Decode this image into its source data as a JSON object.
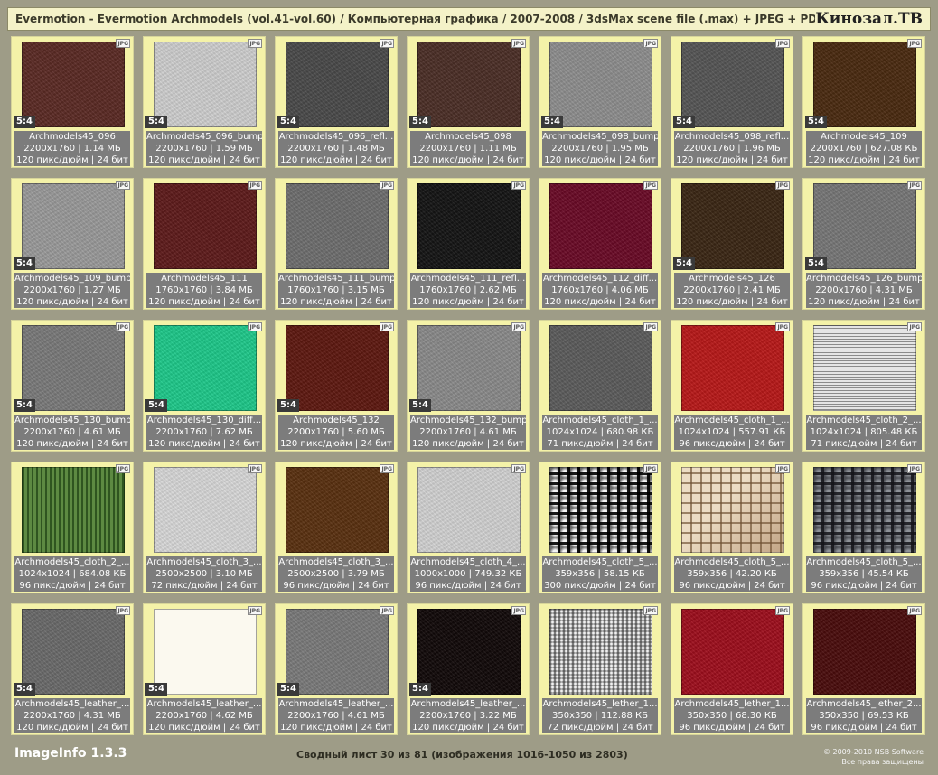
{
  "header": {
    "title": "Evermotion - Evermotion Archmodels (vol.41-vol.60) / Компьютерная графика / 2007-2008 / 3dsMax scene file (.max) + JPEG + PDF",
    "brand": "Кинозал.ТВ"
  },
  "badge_label": "JPG",
  "colors": {
    "background": "#9e9c87",
    "cell": "#f4f2a8",
    "title_bar": "#f4f2c8"
  },
  "thumbnails": [
    {
      "name": "Archmodels45_096",
      "size": "2200x1760 | 1.14 МБ",
      "meta": "120 пикс/дюйм | 24 бит",
      "ratio": "5:4",
      "color": "#5b2a24",
      "tex": "noise"
    },
    {
      "name": "Archmodels45_096_bump",
      "size": "2200x1760 | 1.59 МБ",
      "meta": "120 пикс/дюйм | 24 бит",
      "ratio": "5:4",
      "color": "#cfcfcf",
      "tex": "noise"
    },
    {
      "name": "Archmodels45_096_refl...",
      "size": "2200x1760 | 1.48 МБ",
      "meta": "120 пикс/дюйм | 24 бит",
      "ratio": "5:4",
      "color": "#4a4a4a",
      "tex": "noise"
    },
    {
      "name": "Archmodels45_098",
      "size": "2200x1760 | 1.11 МБ",
      "meta": "120 пикс/дюйм | 24 бит",
      "ratio": "5:4",
      "color": "#4b2e26",
      "tex": "noise"
    },
    {
      "name": "Archmodels45_098_bump",
      "size": "2200x1760 | 1.95 МБ",
      "meta": "120 пикс/дюйм | 24 бит",
      "ratio": "5:4",
      "color": "#8e8e8e",
      "tex": "noise"
    },
    {
      "name": "Archmodels45_098_refl...",
      "size": "2200x1760 | 1.96 МБ",
      "meta": "120 пикс/дюйм | 24 бит",
      "ratio": "5:4",
      "color": "#555555",
      "tex": "noise"
    },
    {
      "name": "Archmodels45_109",
      "size": "2200x1760 | 627.08 КБ",
      "meta": "120 пикс/дюйм | 24 бит",
      "ratio": "5:4",
      "color": "#4a2a10",
      "tex": "noise"
    },
    {
      "name": "Archmodels45_109_bump",
      "size": "2200x1760 | 1.27 МБ",
      "meta": "120 пикс/дюйм | 24 бит",
      "ratio": "5:4",
      "color": "#9a9a9a",
      "tex": "noise"
    },
    {
      "name": "Archmodels45_111",
      "size": "1760x1760 | 3.84 МБ",
      "meta": "120 пикс/дюйм | 24 бит",
      "ratio": "",
      "color": "#5e1a1a",
      "tex": "noise"
    },
    {
      "name": "Archmodels45_111_bump",
      "size": "1760x1760 | 3.15 МБ",
      "meta": "120 пикс/дюйм | 24 бит",
      "ratio": "",
      "color": "#6e6e6e",
      "tex": "noise"
    },
    {
      "name": "Archmodels45_111_refl...",
      "size": "1760x1760 | 2.62 МБ",
      "meta": "120 пикс/дюйм | 24 бит",
      "ratio": "",
      "color": "#141414",
      "tex": "noise"
    },
    {
      "name": "Archmodels45_112_diff...",
      "size": "1760x1760 | 4.06 МБ",
      "meta": "120 пикс/дюйм | 24 бит",
      "ratio": "",
      "color": "#6a0a26",
      "tex": "noise"
    },
    {
      "name": "Archmodels45_126",
      "size": "2200x1760 | 2.41 МБ",
      "meta": "120 пикс/дюйм | 24 бит",
      "ratio": "5:4",
      "color": "#3a2614",
      "tex": "noise"
    },
    {
      "name": "Archmodels45_126_bump",
      "size": "2200x1760 | 4.31 МБ",
      "meta": "120 пикс/дюйм | 24 бит",
      "ratio": "5:4",
      "color": "#777777",
      "tex": "noise"
    },
    {
      "name": "Archmodels45_130_bump",
      "size": "2200x1760 | 4.61 МБ",
      "meta": "120 пикс/дюйм | 24 бит",
      "ratio": "5:4",
      "color": "#7a7a7a",
      "tex": "noise"
    },
    {
      "name": "Archmodels45_130_diff...",
      "size": "2200x1760 | 7.62 МБ",
      "meta": "120 пикс/дюйм | 24 бит",
      "ratio": "5:4",
      "color": "#1ec98a",
      "tex": "noise"
    },
    {
      "name": "Archmodels45_132",
      "size": "2200x1760 | 5.60 МБ",
      "meta": "120 пикс/дюйм | 24 бит",
      "ratio": "5:4",
      "color": "#5e1810",
      "tex": "noise"
    },
    {
      "name": "Archmodels45_132_bump",
      "size": "2200x1760 | 4.61 МБ",
      "meta": "120 пикс/дюйм | 24 бит",
      "ratio": "5:4",
      "color": "#8a8a8a",
      "tex": "noise"
    },
    {
      "name": "Archmodels45_cloth_1_...",
      "size": "1024x1024 | 680.98 КБ",
      "meta": "71 пикс/дюйм | 24 бит",
      "ratio": "",
      "color": "#5c5c5c",
      "tex": "noise"
    },
    {
      "name": "Archmodels45_cloth_1_...",
      "size": "1024x1024 | 557.91 КБ",
      "meta": "96 пикс/дюйм | 24 бит",
      "ratio": "",
      "color": "#b81818",
      "tex": "noise"
    },
    {
      "name": "Archmodels45_cloth_2_...",
      "size": "1024x1024 | 805.48 КБ",
      "meta": "71 пикс/дюйм | 24 бит",
      "ratio": "",
      "color": "#cfcfcf",
      "tex": "stripes"
    },
    {
      "name": "Archmodels45_cloth_2_...",
      "size": "1024x1024 | 684.08 КБ",
      "meta": "96 пикс/дюйм | 24 бит",
      "ratio": "",
      "color": "#4d7a34",
      "tex": "vstripes"
    },
    {
      "name": "Archmodels45_cloth_3_...",
      "size": "2500x2500 | 3.10 МБ",
      "meta": "72 пикс/дюйм | 24 бит",
      "ratio": "",
      "color": "#d8d8d8",
      "tex": "noise"
    },
    {
      "name": "Archmodels45_cloth_3_...",
      "size": "2500x2500 | 3.79 МБ",
      "meta": "96 пикс/дюйм | 24 бит",
      "ratio": "",
      "color": "#5a3010",
      "tex": "noise"
    },
    {
      "name": "Archmodels45_cloth_4_...",
      "size": "1000x1000 | 749.32 КБ",
      "meta": "96 пикс/дюйм | 24 бит",
      "ratio": "",
      "color": "#d2d2d2",
      "tex": "noise"
    },
    {
      "name": "Archmodels45_cloth_5_...",
      "size": "359x356 | 58.15 КБ",
      "meta": "300 пикс/дюйм | 24 бит",
      "ratio": "",
      "color": "#1a1a1a",
      "tex": "weave-bw"
    },
    {
      "name": "Archmodels45_cloth_5_...",
      "size": "359x356 | 42.20 КБ",
      "meta": "96 пикс/дюйм | 24 бит",
      "ratio": "",
      "color": "#d6bfa0",
      "tex": "weave-beige"
    },
    {
      "name": "Archmodels45_cloth_5_...",
      "size": "359x356 | 45.54 КБ",
      "meta": "96 пикс/дюйм | 24 бит",
      "ratio": "",
      "color": "#3e4048",
      "tex": "weave-grey"
    },
    {
      "name": "Archmodels45_leather_...",
      "size": "2200x1760 | 4.31 МБ",
      "meta": "120 пикс/дюйм | 24 бит",
      "ratio": "5:4",
      "color": "#6a6a6a",
      "tex": "noise"
    },
    {
      "name": "Archmodels45_leather_...",
      "size": "2200x1760 | 4.62 МБ",
      "meta": "120 пикс/дюйм | 24 бит",
      "ratio": "5:4",
      "color": "#fbf9ef",
      "tex": "none"
    },
    {
      "name": "Archmodels45_leather_...",
      "size": "2200x1760 | 4.61 МБ",
      "meta": "120 пикс/дюйм | 24 бит",
      "ratio": "5:4",
      "color": "#7a7a7a",
      "tex": "noise"
    },
    {
      "name": "Archmodels45_leather_...",
      "size": "2200x1760 | 3.22 МБ",
      "meta": "120 пикс/дюйм | 24 бит",
      "ratio": "5:4",
      "color": "#110808",
      "tex": "noise"
    },
    {
      "name": "Archmodels45_lether_1...",
      "size": "350x350 | 112.88 КБ",
      "meta": "72 пикс/дюйм | 24 бит",
      "ratio": "",
      "color": "#a0a0a0",
      "tex": "dots"
    },
    {
      "name": "Archmodels45_lether_1...",
      "size": "350x350 | 68.30 КБ",
      "meta": "96 пикс/дюйм | 24 бит",
      "ratio": "",
      "color": "#9e0e1c",
      "tex": "noise"
    },
    {
      "name": "Archmodels45_lether_2...",
      "size": "350x350 | 69.53 КБ",
      "meta": "96 пикс/дюйм | 24 бит",
      "ratio": "",
      "color": "#4a0c0c",
      "tex": "noise"
    }
  ],
  "footer": {
    "app_name": "ImageInfo 1.3.3",
    "summary": "Сводный лист 30 из 81 (изображения 1016-1050 из 2803)",
    "copyright": "© 2009-2010 NSB Software",
    "rights": "Все права защищены"
  }
}
